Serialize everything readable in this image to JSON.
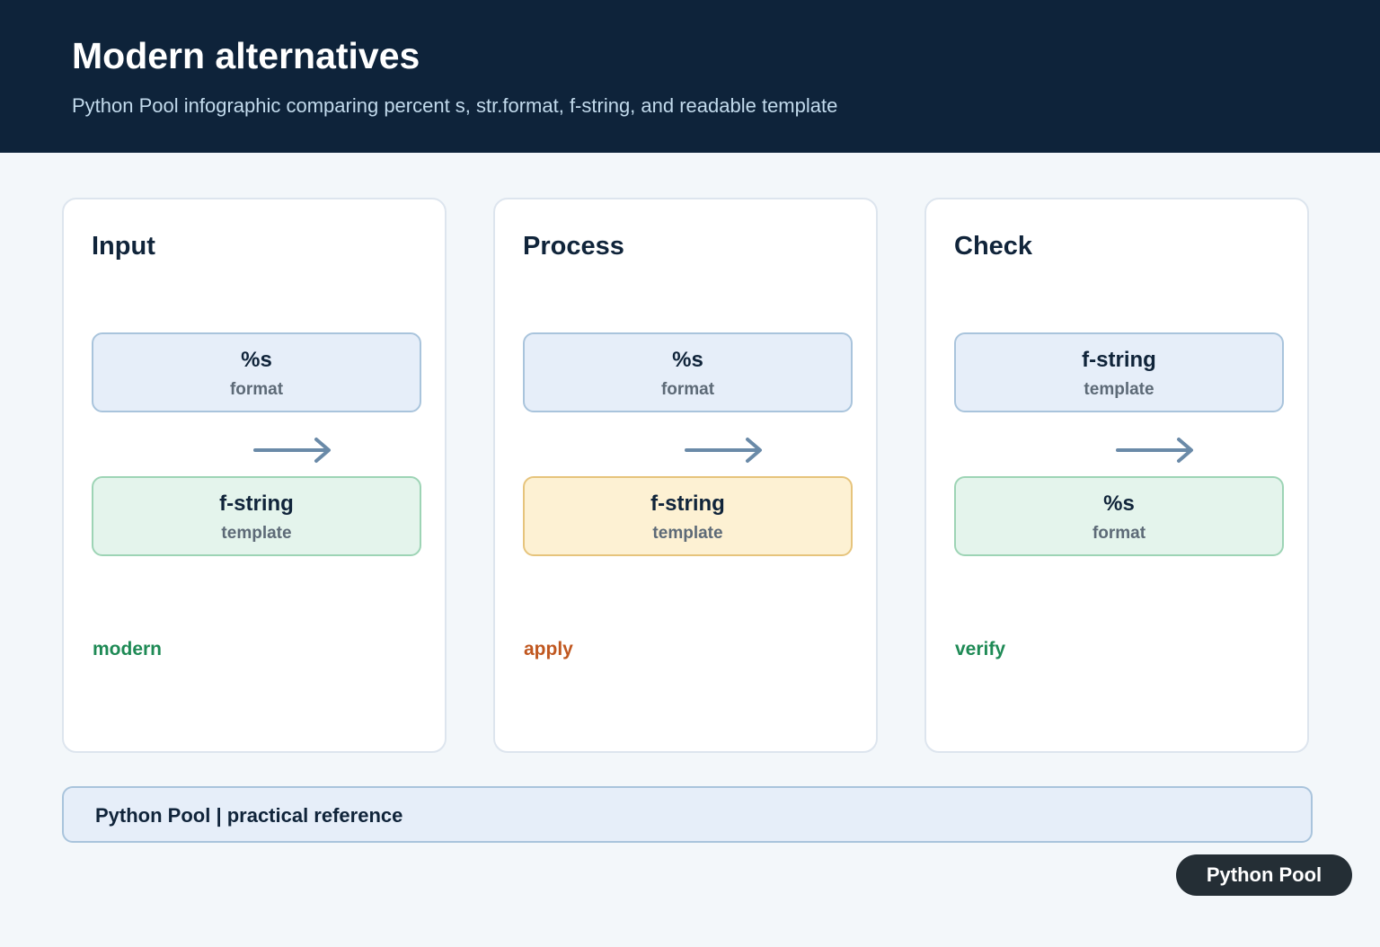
{
  "header": {
    "title": "Modern alternatives",
    "subtitle": "Python Pool infographic comparing percent s, str.format, f-string, and readable template"
  },
  "panels": [
    {
      "title": "Input",
      "top_node": {
        "label": "%s",
        "sub": "format",
        "color": "#e6eef9"
      },
      "bottom_node": {
        "label": "f-string",
        "sub": "template",
        "color": "#e4f4ec"
      },
      "tag": "modern",
      "tag_color": "#1e8a55"
    },
    {
      "title": "Process",
      "top_node": {
        "label": "%s",
        "sub": "format",
        "color": "#e6eef9"
      },
      "bottom_node": {
        "label": "f-string",
        "sub": "template",
        "color": "#fdf1d3"
      },
      "tag": "apply",
      "tag_color": "#c0571f"
    },
    {
      "title": "Check",
      "top_node": {
        "label": "f-string",
        "sub": "template",
        "color": "#e6eef9"
      },
      "bottom_node": {
        "label": "%s",
        "sub": "format",
        "color": "#e4f4ec"
      },
      "tag": "verify",
      "tag_color": "#1e8a55"
    }
  ],
  "footer": {
    "text": "Python Pool | practical reference"
  },
  "badge": {
    "label": "Python Pool"
  },
  "colors": {
    "header_bg": "#0e233a",
    "arrow": "#6a8aa8"
  }
}
